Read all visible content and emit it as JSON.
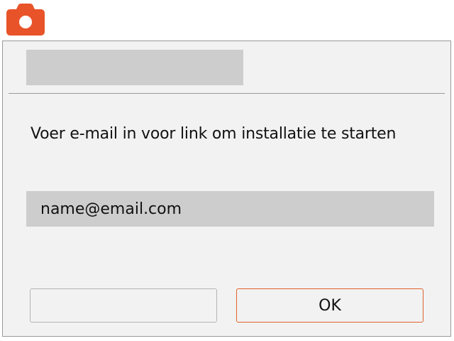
{
  "app": {
    "icon": "camera-icon",
    "accent_color": "#e8532a"
  },
  "dialog": {
    "title": "",
    "prompt": "Voer e-mail in voor link om installatie te starten",
    "email_field": {
      "value": "",
      "placeholder": "name@email.com"
    },
    "buttons": {
      "cancel_label": "",
      "ok_label": "OK",
      "ok_border_color": "#e0632a"
    }
  }
}
